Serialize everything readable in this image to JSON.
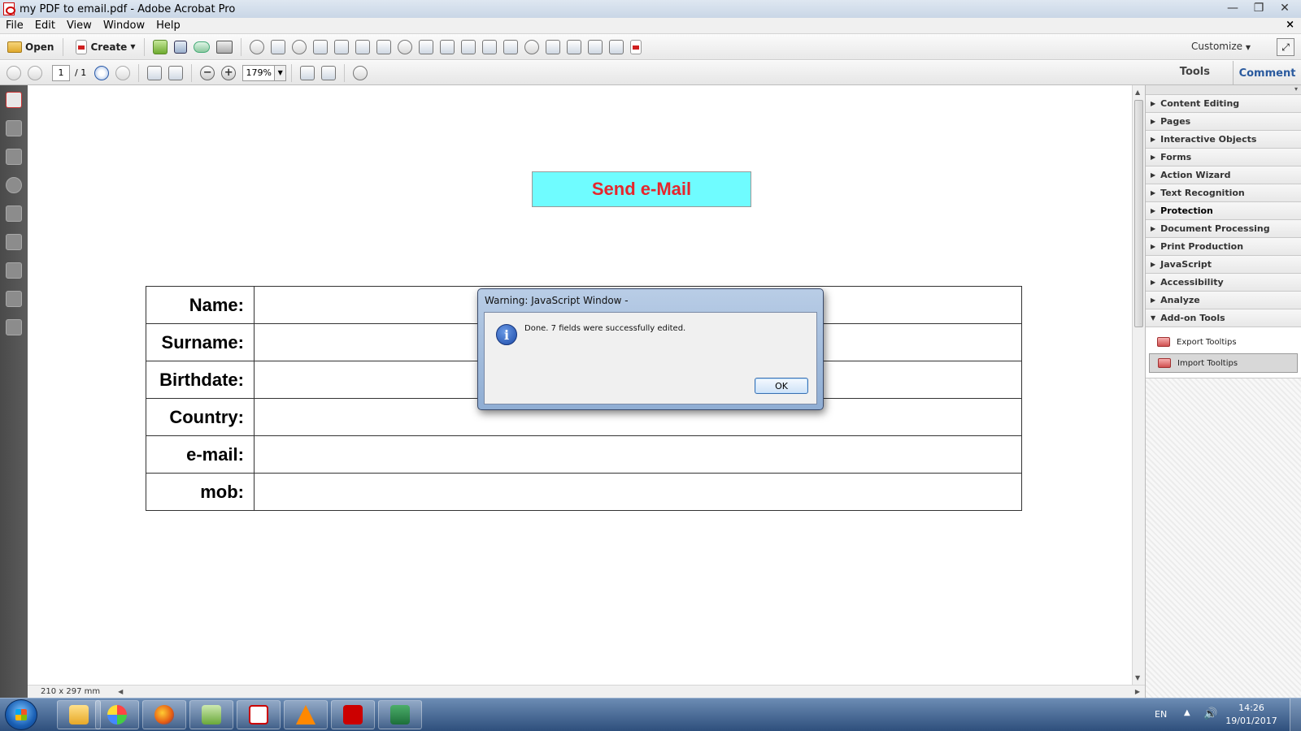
{
  "window": {
    "title": "my PDF to email.pdf - Adobe Acrobat Pro",
    "controls": [
      "—",
      "❐",
      "✕"
    ],
    "doc_close": "×"
  },
  "menu": [
    "File",
    "Edit",
    "View",
    "Window",
    "Help"
  ],
  "toolbar": {
    "open_label": "Open",
    "create_label": "Create",
    "customize_label": "Customize"
  },
  "nav": {
    "page_current": "1",
    "page_total": "/ 1",
    "zoom": "179%",
    "tools_label": "Tools",
    "comment_label": "Comment"
  },
  "document": {
    "send_button": "Send e-Mail",
    "fields": [
      "Name:",
      "Surname:",
      "Birthdate:",
      "Country:",
      "e-mail:",
      "mob:"
    ],
    "page_size": "210 x 297 mm"
  },
  "tools_pane": {
    "panels": [
      {
        "label": "Content Editing",
        "expanded": false
      },
      {
        "label": "Pages",
        "expanded": false
      },
      {
        "label": "Interactive Objects",
        "expanded": false
      },
      {
        "label": "Forms",
        "expanded": false
      },
      {
        "label": "Action Wizard",
        "expanded": false
      },
      {
        "label": "Text Recognition",
        "expanded": false
      },
      {
        "label": "Protection",
        "expanded": false
      },
      {
        "label": "Document Processing",
        "expanded": false
      },
      {
        "label": "Print Production",
        "expanded": false
      },
      {
        "label": "JavaScript",
        "expanded": false
      },
      {
        "label": "Accessibility",
        "expanded": false
      },
      {
        "label": "Analyze",
        "expanded": false
      },
      {
        "label": "Add-on Tools",
        "expanded": true
      }
    ],
    "addon_items": [
      "Export Tooltips",
      "Import Tooltips"
    ]
  },
  "dialog": {
    "title": "Warning: JavaScript Window -",
    "message": "Done. 7 fields were successfully edited.",
    "ok_label": "OK",
    "icon": "information-icon"
  },
  "taskbar": {
    "language": "EN",
    "time": "14:26",
    "date": "19/01/2017"
  },
  "colors": {
    "send_button_bg": "#6ffcff",
    "send_button_text": "#e6262c",
    "comment_link": "#2a5a9e"
  }
}
